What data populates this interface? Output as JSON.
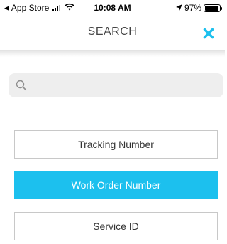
{
  "status_bar": {
    "back_label": "App Store",
    "time": "10:08 AM",
    "battery_percent": "97%",
    "battery_level": 0.97,
    "icons": [
      "back-arrow-icon",
      "signal-icon",
      "wifi-icon",
      "location-icon",
      "battery-icon"
    ]
  },
  "nav": {
    "title": "SEARCH",
    "close_icon": "close-icon",
    "close_color": "#1cc0ee"
  },
  "search": {
    "value": "",
    "placeholder": "",
    "icon": "search-icon"
  },
  "options": [
    {
      "label": "Tracking Number",
      "selected": false
    },
    {
      "label": "Work Order Number",
      "selected": true
    },
    {
      "label": "Service ID",
      "selected": false
    }
  ],
  "colors": {
    "accent": "#1cc0ee",
    "button_border": "#c8c8c8",
    "search_bg": "#eeeeee"
  }
}
